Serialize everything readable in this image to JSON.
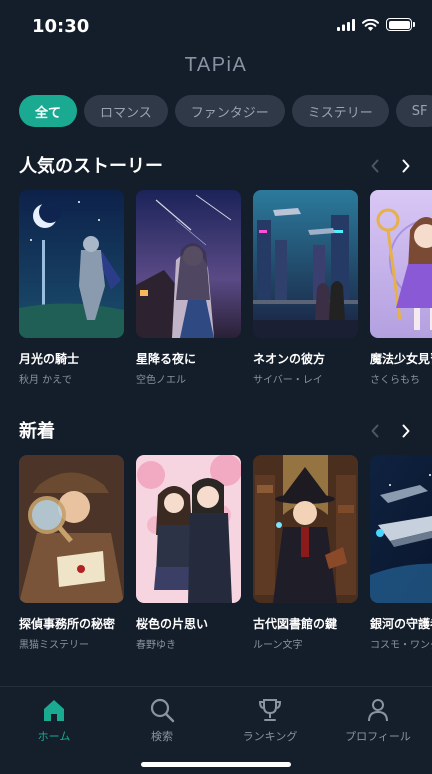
{
  "status_bar": {
    "time": "10:30"
  },
  "app": {
    "title": "TAPiA"
  },
  "categories": [
    "全て",
    "ロマンス",
    "ファンタジー",
    "ミステリー",
    "SF"
  ],
  "popular": {
    "title": "人気のストーリー",
    "stories": [
      {
        "title": "月光の騎士",
        "author": "秋月 かえで"
      },
      {
        "title": "星降る夜に",
        "author": "空色ノエル"
      },
      {
        "title": "ネオンの彼方",
        "author": "サイバー・レイ"
      },
      {
        "title": "魔法少女見習い",
        "author": "さくらもち"
      }
    ]
  },
  "new_arrivals": {
    "title": "新着",
    "stories": [
      {
        "title": "探偵事務所の秘密",
        "author": "黒猫ミステリー"
      },
      {
        "title": "桜色の片思い",
        "author": "春野ゆき"
      },
      {
        "title": "古代図書館の鍵",
        "author": "ルーン文字"
      },
      {
        "title": "銀河の守護者",
        "author": "コスモ・ワンダー"
      }
    ]
  },
  "nav": {
    "home": "ホーム",
    "search": "検索",
    "ranking": "ランキング",
    "profile": "プロフィール"
  },
  "colors": {
    "accent": "#1aa991",
    "background": "#141d2a",
    "chip": "#2f3947"
  }
}
